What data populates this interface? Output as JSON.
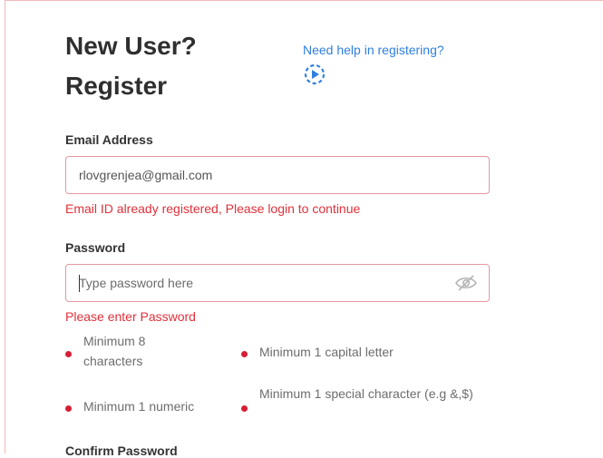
{
  "header": {
    "title_line1": "New User?",
    "title_line2": "Register",
    "help_link": "Need help in registering?",
    "help_icon": "play-circle-icon"
  },
  "email": {
    "label": "Email Address",
    "value": "rlovgrenjea@gmail.com",
    "error": "Email ID already registered, Please login to continue"
  },
  "password": {
    "label": "Password",
    "value": "",
    "placeholder": "Type password here",
    "visibility_icon": "eye-slash-icon",
    "error": "Please enter Password",
    "rules": [
      {
        "text": "Minimum 8 characters"
      },
      {
        "text": "Minimum 1 capital letter"
      },
      {
        "text": "Minimum 1 numeric"
      },
      {
        "text": "Minimum 1 special character (e.g &,$)"
      }
    ]
  },
  "confirm_password": {
    "label": "Confirm Password"
  },
  "colors": {
    "error": "#e0303a",
    "link": "#2f7fe0",
    "bullet": "#d61f35",
    "field_border": "#e3979f"
  }
}
